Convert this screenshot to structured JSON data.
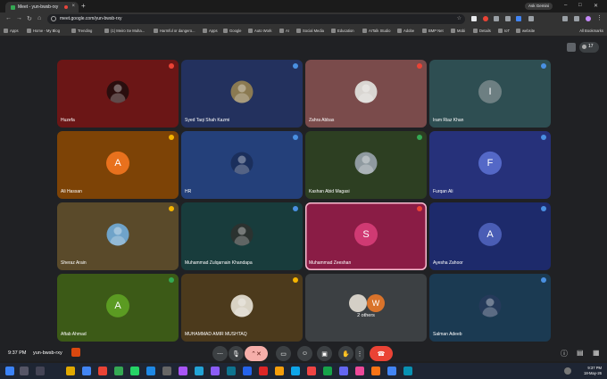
{
  "browser": {
    "tab_title": "Meet - yun-bwsb-rxy",
    "url": "meet.google.com/yun-bwsb-rxy",
    "ask_gemini": "Ask Gemini",
    "profile_initial": "M",
    "bookmarks": [
      "Apps",
      "Home - My Blog",
      "Trending",
      "(1) Meiro Se Muha...",
      "Harmful or dangero...",
      "Apps",
      "Google",
      "Auto Work",
      "AI",
      "Social Media",
      "Education",
      "AITalk Studio",
      "Adobe",
      "BMP Net",
      "Mobi",
      "Details",
      "IoT",
      "website"
    ],
    "all_bookmarks": "All Bookmarks"
  },
  "meet": {
    "participant_count": "17",
    "time": "9:37 PM",
    "code": "yun-bwsb-rxy",
    "tiles": [
      {
        "name": "Huzefa",
        "kind": "photo",
        "bg": "#6b1616",
        "avatar_bg": "#2a0e0e",
        "mic": "#ea4335"
      },
      {
        "name": "Syed Taqi Shah Kazmi",
        "kind": "photo",
        "bg": "#23315e",
        "avatar_bg": "#8b7a52",
        "mic": "#4a90e2"
      },
      {
        "name": "Zahra Abbas",
        "kind": "photo",
        "bg": "#7a4b4b",
        "avatar_bg": "#d9d6d2",
        "mic": "#ea4335"
      },
      {
        "name": "Iram Riaz Khan",
        "kind": "letter",
        "letter": "I",
        "bg": "#2e4e52",
        "avatar_bg": "#6d7f82",
        "mic": "#4a90e2"
      },
      {
        "name": "Ali Hassan",
        "kind": "letter",
        "letter": "A",
        "bg": "#7d4306",
        "avatar_bg": "#e8711d",
        "mic": "#f4b400"
      },
      {
        "name": "HR",
        "kind": "photo",
        "bg": "#24407a",
        "avatar_bg": "#1b2f5c",
        "mic": "#4a90e2"
      },
      {
        "name": "Kashan Abid Magasi",
        "kind": "photo",
        "bg": "#2d3f22",
        "avatar_bg": "#8f9aa0",
        "mic": "#34a853"
      },
      {
        "name": "Furqan Ali",
        "kind": "letter",
        "letter": "F",
        "bg": "#26317a",
        "avatar_bg": "#5468c7",
        "mic": "#4a90e2"
      },
      {
        "name": "Sheraz Arain",
        "kind": "photo",
        "bg": "#5a4a2a",
        "avatar_bg": "#6fa3c9",
        "mic": "#f4b400"
      },
      {
        "name": "Muhammad Zulqarnain Khandapa",
        "kind": "photo",
        "bg": "#183c3c",
        "avatar_bg": "#2b3230",
        "mic": "#4a90e2"
      },
      {
        "name": "Muhammad Zeeshan",
        "kind": "letter",
        "letter": "S",
        "bg": "#8a1c45",
        "avatar_bg": "#d03a73",
        "mic": "#ea4335",
        "active": true
      },
      {
        "name": "Ayesha Zahoor",
        "kind": "letter",
        "letter": "A",
        "bg": "#1d2a6b",
        "avatar_bg": "#4a5db5",
        "mic": "#4a90e2"
      },
      {
        "name": "Aftab Ahmad",
        "kind": "letter",
        "letter": "A",
        "bg": "#3c5a17",
        "avatar_bg": "#5b9b22",
        "mic": "#34a853"
      },
      {
        "name": "MUHAMMAD AMIR MUSHTAQ",
        "kind": "photo",
        "bg": "#4c3a1c",
        "avatar_bg": "#d8d2c4",
        "mic": "#f4b400"
      },
      {
        "name": "",
        "kind": "others",
        "others_label": "2 others",
        "bg": "#3c4043",
        "avatar_bg": "#d9732b",
        "letter": "W"
      },
      {
        "name": "Salman Adeeb",
        "kind": "photo",
        "bg": "#1b3a52",
        "avatar_bg": "#253a5a",
        "mic": "#4a90e2"
      }
    ]
  },
  "taskbar": {
    "time": "9:37 PM",
    "date": "18-May-26"
  }
}
